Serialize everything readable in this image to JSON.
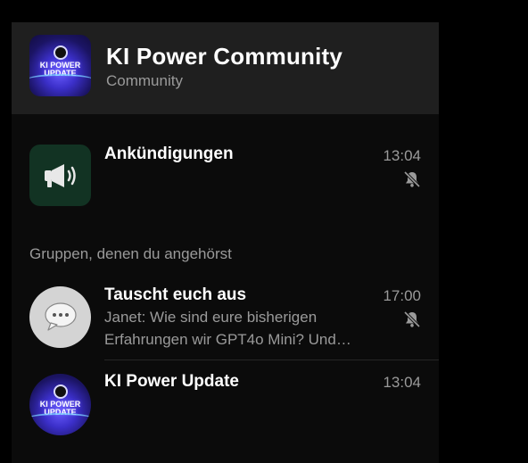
{
  "header": {
    "title": "KI Power Community",
    "subtitle": "Community",
    "logo_text": "KI POWER UPDATE"
  },
  "announcements": {
    "name": "Ankündigungen",
    "time": "13:04",
    "muted": true,
    "icon": "megaphone-icon",
    "icon_bg": "#123323"
  },
  "section": {
    "label": "Gruppen, denen du angehörst"
  },
  "groups": [
    {
      "name": "Tauscht euch aus",
      "time": "17:00",
      "muted": true,
      "preview_sender": "Janet",
      "preview_text": "Wie sind eure bisherigen Erfahrungen wir GPT4o Mini?  Und…",
      "icon": "chat-bubble-icon"
    },
    {
      "name": "KI Power Update",
      "time": "13:04",
      "logo_text": "KI POWER UPDATE"
    }
  ],
  "colors": {
    "background": "#000000",
    "panel": "#0b0b0b",
    "header": "#1f1f1f",
    "secondary_text": "#9a9a9a"
  }
}
